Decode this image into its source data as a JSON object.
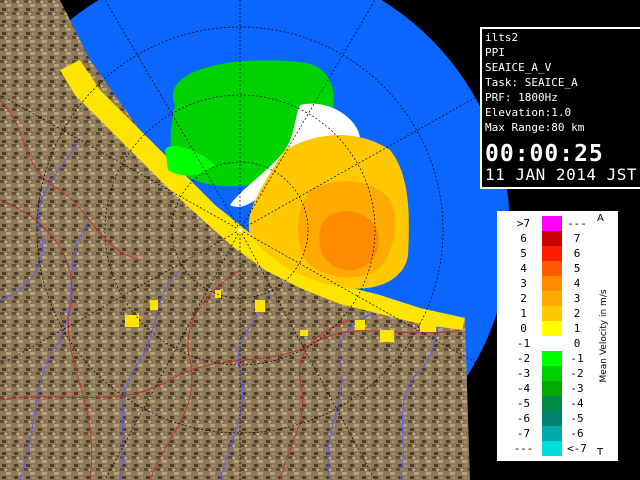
{
  "info": {
    "station": "ilts2",
    "product": "PPI",
    "field": "SEAICE_A_V",
    "task": "Task: SEAICE_A",
    "prf": "PRF: 1800Hz",
    "elevation": "Elevation:1.0",
    "max_range": "Max Range:80 km",
    "time": "00:00:25",
    "date": "11 JAN 2014 JST"
  },
  "legend": {
    "title": "Mean Velocity in m/s",
    "top_marker": "A",
    "bottom_marker": "T",
    "rows": [
      {
        "left": ">7",
        "right": "---",
        "color": "#ff00ff"
      },
      {
        "left": "6",
        "right": "7",
        "color": "#c80000"
      },
      {
        "left": "5",
        "right": "6",
        "color": "#ff1e00"
      },
      {
        "left": "4",
        "right": "5",
        "color": "#ff5a00"
      },
      {
        "left": "3",
        "right": "4",
        "color": "#ff8c00"
      },
      {
        "left": "2",
        "right": "3",
        "color": "#ffaa00"
      },
      {
        "left": "1",
        "right": "2",
        "color": "#ffc800"
      },
      {
        "left": "0",
        "right": "1",
        "color": "#ffff00"
      },
      {
        "left": "-1",
        "right": "0",
        "color": "#ffffff"
      },
      {
        "left": "-2",
        "right": "-1",
        "color": "#00ff00"
      },
      {
        "left": "-3",
        "right": "-2",
        "color": "#00d200"
      },
      {
        "left": "-4",
        "right": "-3",
        "color": "#00aa00"
      },
      {
        "left": "-5",
        "right": "-4",
        "color": "#008c46"
      },
      {
        "left": "-6",
        "right": "-5",
        "color": "#00826e"
      },
      {
        "left": "-7",
        "right": "-6",
        "color": "#00aaaa"
      },
      {
        "left": "---",
        "right": "<-7",
        "color": "#00dcdc"
      }
    ]
  },
  "colors": {
    "sea": "#0a66ff",
    "land": "#8a7656",
    "coast": "#ffe400",
    "range_ring": "#000000"
  }
}
